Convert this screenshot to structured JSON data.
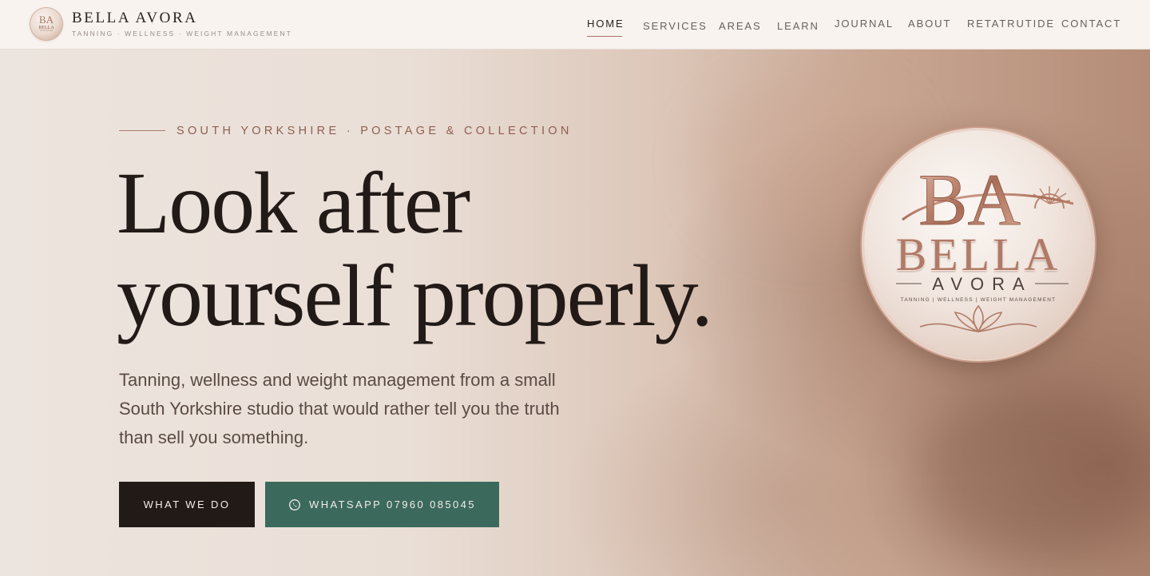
{
  "brand": {
    "name": "BELLA AVORA",
    "tagline": "TANNING · WELLNESS · WEIGHT MANAGEMENT",
    "logo_icon": "ba-monogram-medallion-icon"
  },
  "nav": {
    "items": [
      {
        "label": "HOME",
        "active": true
      },
      {
        "label": "SERVICES",
        "active": false
      },
      {
        "label": "AREAS",
        "active": false
      },
      {
        "label": "LEARN",
        "active": false
      },
      {
        "label": "JOURNAL",
        "active": false
      },
      {
        "label": "ABOUT",
        "active": false
      },
      {
        "label": "RETATRUTIDE",
        "active": false
      },
      {
        "label": "CONTACT",
        "active": false
      }
    ]
  },
  "hero": {
    "eyebrow": "SOUTH YORKSHIRE · POSTAGE & COLLECTION",
    "headline_line1": "Look after",
    "headline_line2": "yourself properly.",
    "subtext": "Tanning, wellness and weight management from a small South Yorkshire studio that would rather tell you the truth than sell you something.",
    "primary_button": "WHAT WE DO",
    "whatsapp_button": "WHATSAPP 07960 085045",
    "whatsapp_icon": "whatsapp-icon"
  },
  "medallion": {
    "monogram": "BA",
    "name": "BELLA",
    "subname": "AVORA",
    "tagline": "TANNING  |  WELLNESS  |  WEIGHT MANAGEMENT"
  },
  "colors": {
    "header_bg": "#f8f3ef",
    "text_dark": "#221a17",
    "accent_rose": "#8e5f50",
    "button_dark": "#221a17",
    "button_green": "#3b6a5d",
    "rose_gold": "#b07a66"
  }
}
